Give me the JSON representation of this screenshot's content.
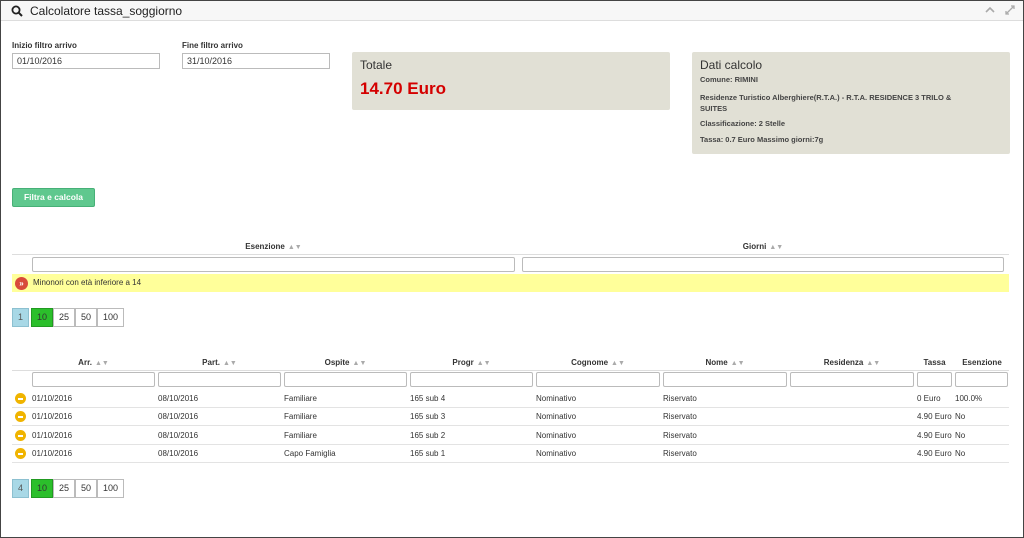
{
  "window": {
    "title": "Calcolatore tassa_soggiorno"
  },
  "filters": {
    "start_label": "Inizio filtro arrivo",
    "start_value": "01/10/2016",
    "end_label": "Fine filtro arrivo",
    "end_value": "31/10/2016"
  },
  "total": {
    "title": "Totale",
    "value": "14.70 Euro"
  },
  "details": {
    "title": "Dati calcolo",
    "comune": "Comune: RIMINI",
    "struttura_1": "Residenze Turistico Alberghiere(R.T.A.) - R.T.A. RESIDENCE 3 TRILO &",
    "struttura_2": "SUITES",
    "classificazione": "Classificazione: 2 Stelle",
    "tassa": "Tassa: 0.7 Euro Massimo giorni:7g"
  },
  "filter_button": "Filtra e calcola",
  "exemptions_table": {
    "headers": [
      "Esenzione",
      "Giorni"
    ],
    "rows": [
      {
        "label": "Minonori con età inferiore a 14"
      }
    ],
    "pager": {
      "count": "1",
      "sizes": [
        "10",
        "25",
        "50",
        "100"
      ],
      "active": "10"
    }
  },
  "guests_table": {
    "headers": [
      "Arr.",
      "Part.",
      "Ospite",
      "Progr",
      "Cognome",
      "Nome",
      "Residenza",
      "Tassa",
      "Esenzione"
    ],
    "rows": [
      {
        "arr": "01/10/2016",
        "part": "08/10/2016",
        "ospite": "Familiare",
        "progr": "165 sub 4",
        "cognome": "Nominativo",
        "nome": "Riservato",
        "residenza": "",
        "tassa": "0 Euro",
        "esenzione": "100.0%"
      },
      {
        "arr": "01/10/2016",
        "part": "08/10/2016",
        "ospite": "Familiare",
        "progr": "165 sub 3",
        "cognome": "Nominativo",
        "nome": "Riservato",
        "residenza": "",
        "tassa": "4.90 Euro",
        "esenzione": "No"
      },
      {
        "arr": "01/10/2016",
        "part": "08/10/2016",
        "ospite": "Familiare",
        "progr": "165 sub 2",
        "cognome": "Nominativo",
        "nome": "Riservato",
        "residenza": "",
        "tassa": "4.90 Euro",
        "esenzione": "No"
      },
      {
        "arr": "01/10/2016",
        "part": "08/10/2016",
        "ospite": "Capo Famiglia",
        "progr": "165 sub 1",
        "cognome": "Nominativo",
        "nome": "Riservato",
        "residenza": "",
        "tassa": "4.90 Euro",
        "esenzione": "No"
      }
    ],
    "pager": {
      "count": "4",
      "sizes": [
        "10",
        "25",
        "50",
        "100"
      ],
      "active": "10"
    }
  },
  "colors": {
    "total_value": "#d40000",
    "button": "#5fc88e",
    "info_row": "#ffff9a",
    "page_active": "#2bbf2b",
    "page_count": "#a8d8e6",
    "panel": "#e1e0d5"
  },
  "icons": {
    "title": "search-icon",
    "collapse": "chevron-up-icon",
    "expand": "expand-icon",
    "info_row": "double-chevron-icon",
    "guest_row": "minus-circle-icon",
    "sort": "sort-icon"
  }
}
